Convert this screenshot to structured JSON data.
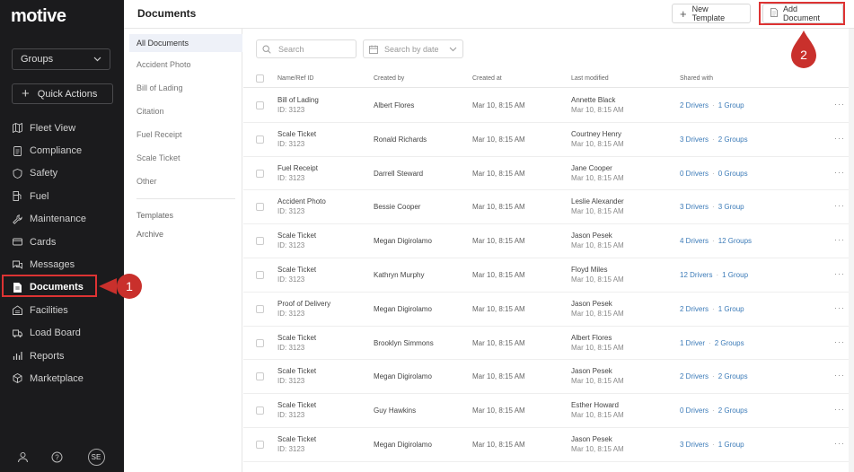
{
  "app": {
    "logo": "motive"
  },
  "sidebar": {
    "groups_label": "Groups",
    "quick_actions_label": "Quick Actions",
    "items": [
      {
        "label": "Fleet View",
        "icon": "map-icon"
      },
      {
        "label": "Compliance",
        "icon": "clipboard-icon"
      },
      {
        "label": "Safety",
        "icon": "shield-icon"
      },
      {
        "label": "Fuel",
        "icon": "fuel-pump-icon"
      },
      {
        "label": "Maintenance",
        "icon": "wrench-icon"
      },
      {
        "label": "Cards",
        "icon": "card-icon"
      },
      {
        "label": "Messages",
        "icon": "chat-icon"
      },
      {
        "label": "Documents",
        "icon": "document-icon",
        "active": true
      },
      {
        "label": "Facilities",
        "icon": "building-icon"
      },
      {
        "label": "Load Board",
        "icon": "truck-icon"
      },
      {
        "label": "Reports",
        "icon": "chart-icon"
      },
      {
        "label": "Marketplace",
        "icon": "cube-icon"
      }
    ],
    "avatar_initials": "SE"
  },
  "header": {
    "title": "Documents",
    "new_template_label": "New Template",
    "add_document_label": "Add Document"
  },
  "callouts": {
    "one": "1",
    "two": "2"
  },
  "subnav": {
    "items": [
      "All Documents",
      "Accident Photo",
      "Bill of Lading",
      "Citation",
      "Fuel Receipt",
      "Scale Ticket",
      "Other"
    ],
    "extra": [
      "Templates",
      "Archive"
    ]
  },
  "toolbar": {
    "search_placeholder": "Search",
    "date_placeholder": "Search by date"
  },
  "table": {
    "columns": [
      "Name/Ref ID",
      "Created by",
      "Created at",
      "Last modified",
      "Shared with"
    ],
    "rows": [
      {
        "name": "Bill of Lading",
        "ref": "ID: 3123",
        "created_by": "Albert Flores",
        "created_at": "Mar 10, 8:15 AM",
        "mod_by": "Annette Black",
        "mod_at": "Mar 10, 8:15 AM",
        "drivers": "2 Drivers",
        "groups": "1 Group"
      },
      {
        "name": "Scale Ticket",
        "ref": "ID: 3123",
        "created_by": "Ronald Richards",
        "created_at": "Mar 10, 8:15 AM",
        "mod_by": "Courtney Henry",
        "mod_at": "Mar 10, 8:15 AM",
        "drivers": "3 Drivers",
        "groups": "2 Groups"
      },
      {
        "name": "Fuel Receipt",
        "ref": "ID: 3123",
        "created_by": "Darrell Steward",
        "created_at": "Mar 10, 8:15 AM",
        "mod_by": "Jane Cooper",
        "mod_at": "Mar 10, 8:15 AM",
        "drivers": "0 Drivers",
        "groups": "0 Groups"
      },
      {
        "name": "Accident Photo",
        "ref": "ID: 3123",
        "created_by": "Bessie Cooper",
        "created_at": "Mar 10, 8:15 AM",
        "mod_by": "Leslie Alexander",
        "mod_at": "Mar 10, 8:15 AM",
        "drivers": "3 Drivers",
        "groups": "3 Group"
      },
      {
        "name": "Scale Ticket",
        "ref": "ID: 3123",
        "created_by": "Megan Digirolamo",
        "created_at": "Mar 10, 8:15 AM",
        "mod_by": "Jason Pesek",
        "mod_at": "Mar 10, 8:15 AM",
        "drivers": "4 Drivers",
        "groups": "12 Groups"
      },
      {
        "name": "Scale Ticket",
        "ref": "ID: 3123",
        "created_by": "Kathryn Murphy",
        "created_at": "Mar 10, 8:15 AM",
        "mod_by": "Floyd Miles",
        "mod_at": "Mar 10, 8:15 AM",
        "drivers": "12 Drivers",
        "groups": "1 Group"
      },
      {
        "name": "Proof of Delivery",
        "ref": "ID: 3123",
        "created_by": "Megan Digirolamo",
        "created_at": "Mar 10, 8:15 AM",
        "mod_by": "Jason Pesek",
        "mod_at": "Mar 10, 8:15 AM",
        "drivers": "2 Drivers",
        "groups": "1 Group"
      },
      {
        "name": "Scale Ticket",
        "ref": "ID: 3123",
        "created_by": "Brooklyn Simmons",
        "created_at": "Mar 10, 8:15 AM",
        "mod_by": "Albert Flores",
        "mod_at": "Mar 10, 8:15 AM",
        "drivers": "1 Driver",
        "groups": "2 Groups"
      },
      {
        "name": "Scale Ticket",
        "ref": "ID: 3123",
        "created_by": "Megan Digirolamo",
        "created_at": "Mar 10, 8:15 AM",
        "mod_by": "Jason Pesek",
        "mod_at": "Mar 10, 8:15 AM",
        "drivers": "2 Drivers",
        "groups": "2 Groups"
      },
      {
        "name": "Scale Ticket",
        "ref": "ID: 3123",
        "created_by": "Guy Hawkins",
        "created_at": "Mar 10, 8:15 AM",
        "mod_by": "Esther Howard",
        "mod_at": "Mar 10, 8:15 AM",
        "drivers": "0 Drivers",
        "groups": "2 Groups"
      },
      {
        "name": "Scale Ticket",
        "ref": "ID: 3123",
        "created_by": "Megan Digirolamo",
        "created_at": "Mar 10, 8:15 AM",
        "mod_by": "Jason Pesek",
        "mod_at": "Mar 10, 8:15 AM",
        "drivers": "3 Drivers",
        "groups": "1 Group"
      }
    ],
    "more_label": "···"
  },
  "colors": {
    "sidebar_bg": "#1b1b1d",
    "link": "#3c7bb8",
    "highlight": "#d33",
    "callout": "#c9302c"
  }
}
